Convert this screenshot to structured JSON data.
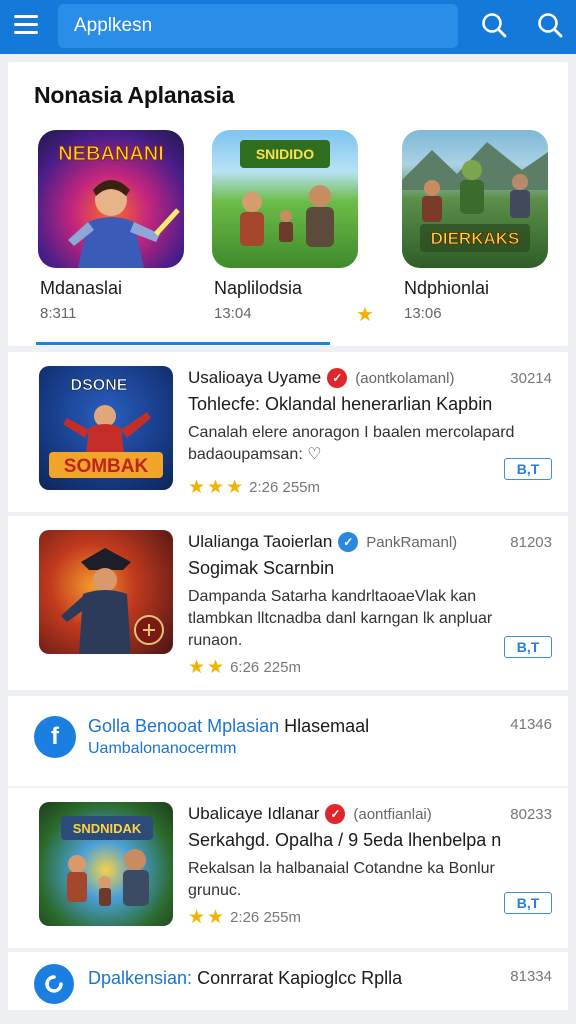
{
  "appbar": {
    "title": "Applkesn",
    "icons": [
      "menu-icon",
      "search-icon",
      "search-icon"
    ]
  },
  "featured": {
    "title": "Nonasia Aplanasia",
    "games": [
      {
        "name": "Mdanaslai",
        "meta": "8:311",
        "art_label": "NEBANANI"
      },
      {
        "name": "Naplilodsia",
        "meta": "13:04",
        "art_label": "SNIDIDO"
      },
      {
        "name": "Ndphionlai",
        "meta": "13:06",
        "art_label": "DIERKAKS"
      }
    ]
  },
  "list": [
    {
      "title": "Usalioaya Uyame",
      "publisher": "(aontkolamanl)",
      "count": "30214",
      "headline": "Tohlecfe: Oklandal henerarlian Kapbin",
      "description": "Canalah elere anoragon I baalen mercolapard badaoupamsan: ♡",
      "rating": "2:26  255m",
      "button": "B,T",
      "art_label": "SOMBAK",
      "badge_color": "#e0262a"
    },
    {
      "title": "Ulalianga Taoierlan",
      "publisher": "PankRamanl)",
      "count": "81203",
      "headline": "Sogimak Scarnbin",
      "description": "Dampanda Satarha kandrltaoaeVlak kan tlambkan lltcnadba danl karngan lk anpluar runaon.",
      "rating": "6:26  225m",
      "button": "B,T",
      "art_label": "",
      "badge_color": "#2b88e0"
    },
    {
      "title": "Ubalicaye Idlanar",
      "publisher": "(aontfianlai)",
      "count": "80233",
      "headline": "Serkahgd. Opalha / 9 5eda lhenbelpa n",
      "description": "Rekalsan la halbanaial Cotandne ka Bonlur grunuc.",
      "rating": "2:26  255m",
      "button": "B,T",
      "art_label": "SNDNIDAK",
      "badge_color": "#e0262a"
    }
  ],
  "promos": [
    {
      "line1_blue": "Golla Benooat Mplasian",
      "line1_dark": "Hlasemaal",
      "line2": "Uambalonanocermm",
      "count": "41346",
      "icon": "f"
    },
    {
      "line1_blue": "Dpalkensian:",
      "line1_dark": "Conrrarat Kapioglcc Rplla",
      "line2": "",
      "count": "81334",
      "icon": "c"
    }
  ],
  "colors": {
    "accent": "#1479d8",
    "star": "#f0b400"
  }
}
